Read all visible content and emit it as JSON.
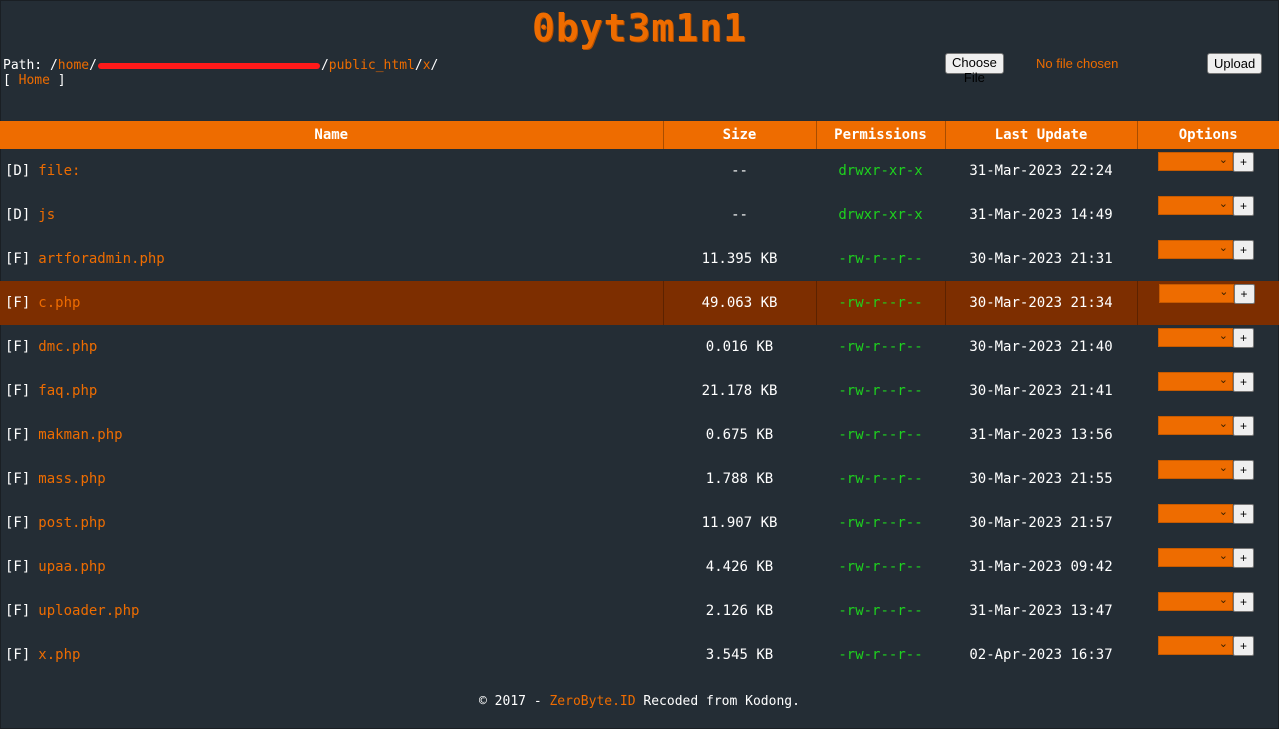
{
  "header": {
    "title": "0byt3m1n1"
  },
  "path": {
    "label": "Path:",
    "sep": "/",
    "segments": [
      "home",
      "public_html",
      "x"
    ]
  },
  "nav": {
    "open": "[",
    "home": "Home",
    "close": "]"
  },
  "upload": {
    "choose_label": "Choose File",
    "no_file_text": "No file chosen",
    "upload_label": "Upload"
  },
  "table": {
    "headers": [
      "Name",
      "Size",
      "Permissions",
      "Last Update",
      "Options"
    ],
    "rows": [
      {
        "tag": "[D]",
        "name": "file:",
        "size": "--",
        "perm": "drwxr-xr-x",
        "date": "31-Mar-2023 22:24"
      },
      {
        "tag": "[D]",
        "name": "js",
        "size": "--",
        "perm": "drwxr-xr-x",
        "date": "31-Mar-2023 14:49"
      },
      {
        "tag": "[F]",
        "name": "artforadmin.php",
        "size": "11.395 KB",
        "perm": "-rw-r--r--",
        "date": "30-Mar-2023 21:31"
      },
      {
        "tag": "[F]",
        "name": "c.php",
        "size": "49.063 KB",
        "perm": "-rw-r--r--",
        "date": "30-Mar-2023 21:34"
      },
      {
        "tag": "[F]",
        "name": "dmc.php",
        "size": "0.016 KB",
        "perm": "-rw-r--r--",
        "date": "30-Mar-2023 21:40"
      },
      {
        "tag": "[F]",
        "name": "faq.php",
        "size": "21.178 KB",
        "perm": "-rw-r--r--",
        "date": "30-Mar-2023 21:41"
      },
      {
        "tag": "[F]",
        "name": "makman.php",
        "size": "0.675 KB",
        "perm": "-rw-r--r--",
        "date": "31-Mar-2023 13:56"
      },
      {
        "tag": "[F]",
        "name": "mass.php",
        "size": "1.788 KB",
        "perm": "-rw-r--r--",
        "date": "30-Mar-2023 21:55"
      },
      {
        "tag": "[F]",
        "name": "post.php",
        "size": "11.907 KB",
        "perm": "-rw-r--r--",
        "date": "30-Mar-2023 21:57"
      },
      {
        "tag": "[F]",
        "name": "upaa.php",
        "size": "4.426 KB",
        "perm": "-rw-r--r--",
        "date": "31-Mar-2023 09:42"
      },
      {
        "tag": "[F]",
        "name": "uploader.php",
        "size": "2.126 KB",
        "perm": "-rw-r--r--",
        "date": "31-Mar-2023 13:47"
      },
      {
        "tag": "[F]",
        "name": "x.php",
        "size": "3.545 KB",
        "perm": "-rw-r--r--",
        "date": "02-Apr-2023 16:37"
      }
    ],
    "option_plus": "+"
  },
  "footer": {
    "prefix": "© 2017 - ",
    "brand": "ZeroByte.ID",
    "suffix": " Recoded from Kodong."
  },
  "colors": {
    "accent": "#ee6c00",
    "background": "#242d35",
    "permission": "#1ed31e",
    "highlight_row": "#7d2e00",
    "redaction": "#ff1a1a"
  }
}
